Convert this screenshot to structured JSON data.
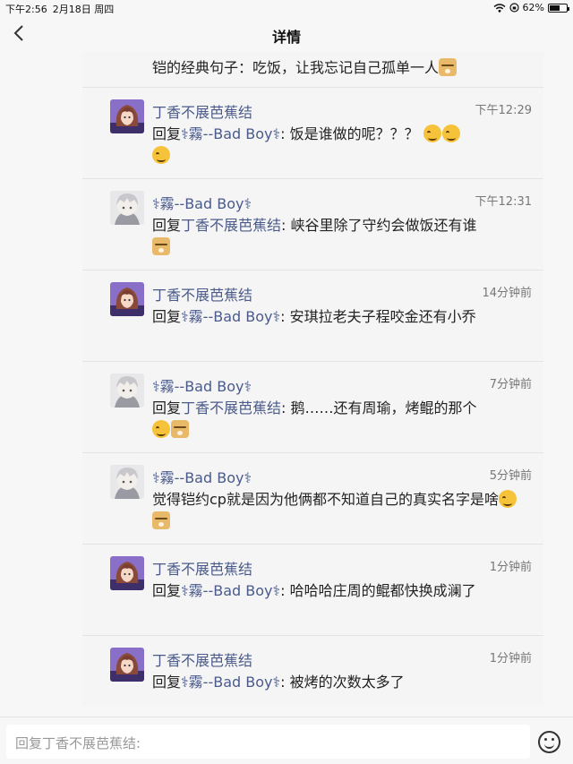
{
  "status_bar": {
    "time": "下午2:56",
    "date": "2月18日 周四",
    "battery_text": "62%",
    "battery_level": 0.62,
    "icons": [
      "wifi-icon",
      "orientation-lock-icon",
      "battery-icon"
    ]
  },
  "nav": {
    "back_icon": "chevron-left-icon",
    "title": "详情"
  },
  "users": {
    "a": "丁香不展芭蕉结",
    "b": "⚕霧--Bad Boy⚕"
  },
  "messages": [
    {
      "author": "",
      "time": "",
      "prefix": "",
      "mention": "",
      "text": "铠的经典句子：吃饭，让我忘记自己孤单一人",
      "emojis": [
        "doge"
      ],
      "avatar": "boy"
    },
    {
      "author": "丁香不展芭蕉结",
      "time": "下午12:29",
      "prefix": "回复",
      "mention": "⚕霧--Bad Boy⚕",
      "text": ": 饭是谁做的呢？？？ ",
      "emojis": [
        "smile",
        "smile",
        "smile"
      ],
      "avatar": "girl"
    },
    {
      "author": "⚕霧--Bad Boy⚕",
      "time": "下午12:31",
      "prefix": "回复",
      "mention": "丁香不展芭蕉结",
      "text": ": 峡谷里除了守约会做饭还有谁",
      "emojis": [
        "doge"
      ],
      "avatar": "boy"
    },
    {
      "author": "丁香不展芭蕉结",
      "time": "14分钟前",
      "prefix": "回复",
      "mention": "⚕霧--Bad Boy⚕",
      "text": ": 安琪拉老夫子程咬金还有小乔",
      "emojis": [],
      "avatar": "girl"
    },
    {
      "author": "⚕霧--Bad Boy⚕",
      "time": "7分钟前",
      "prefix": "回复",
      "mention": "丁香不展芭蕉结",
      "text": ": 鹅……还有周瑜，烤鲲的那个",
      "emojis": [
        "smile",
        "doge"
      ],
      "avatar": "boy"
    },
    {
      "author": "⚕霧--Bad Boy⚕",
      "time": "5分钟前",
      "prefix": "",
      "mention": "",
      "text": "觉得铠约cp就是因为他俩都不知道自己的真实名字是啥",
      "emojis": [
        "smile",
        "doge"
      ],
      "avatar": "boy"
    },
    {
      "author": "丁香不展芭蕉结",
      "time": "1分钟前",
      "prefix": "回复",
      "mention": "⚕霧--Bad Boy⚕",
      "text": ": 哈哈哈庄周的鲲都快换成澜了",
      "emojis": [],
      "avatar": "girl"
    },
    {
      "author": "丁香不展芭蕉结",
      "time": "1分钟前",
      "prefix": "回复",
      "mention": "⚕霧--Bad Boy⚕",
      "text": ": 被烤的次数太多了",
      "emojis": [],
      "avatar": "girl"
    }
  ],
  "input": {
    "placeholder": "回复丁香不展芭蕉结:",
    "emoji_button_icon": "smiley-face-icon"
  },
  "colors": {
    "username": "#4a5a8a",
    "background": "#f7f7f7",
    "card": "#f5f5f5"
  }
}
